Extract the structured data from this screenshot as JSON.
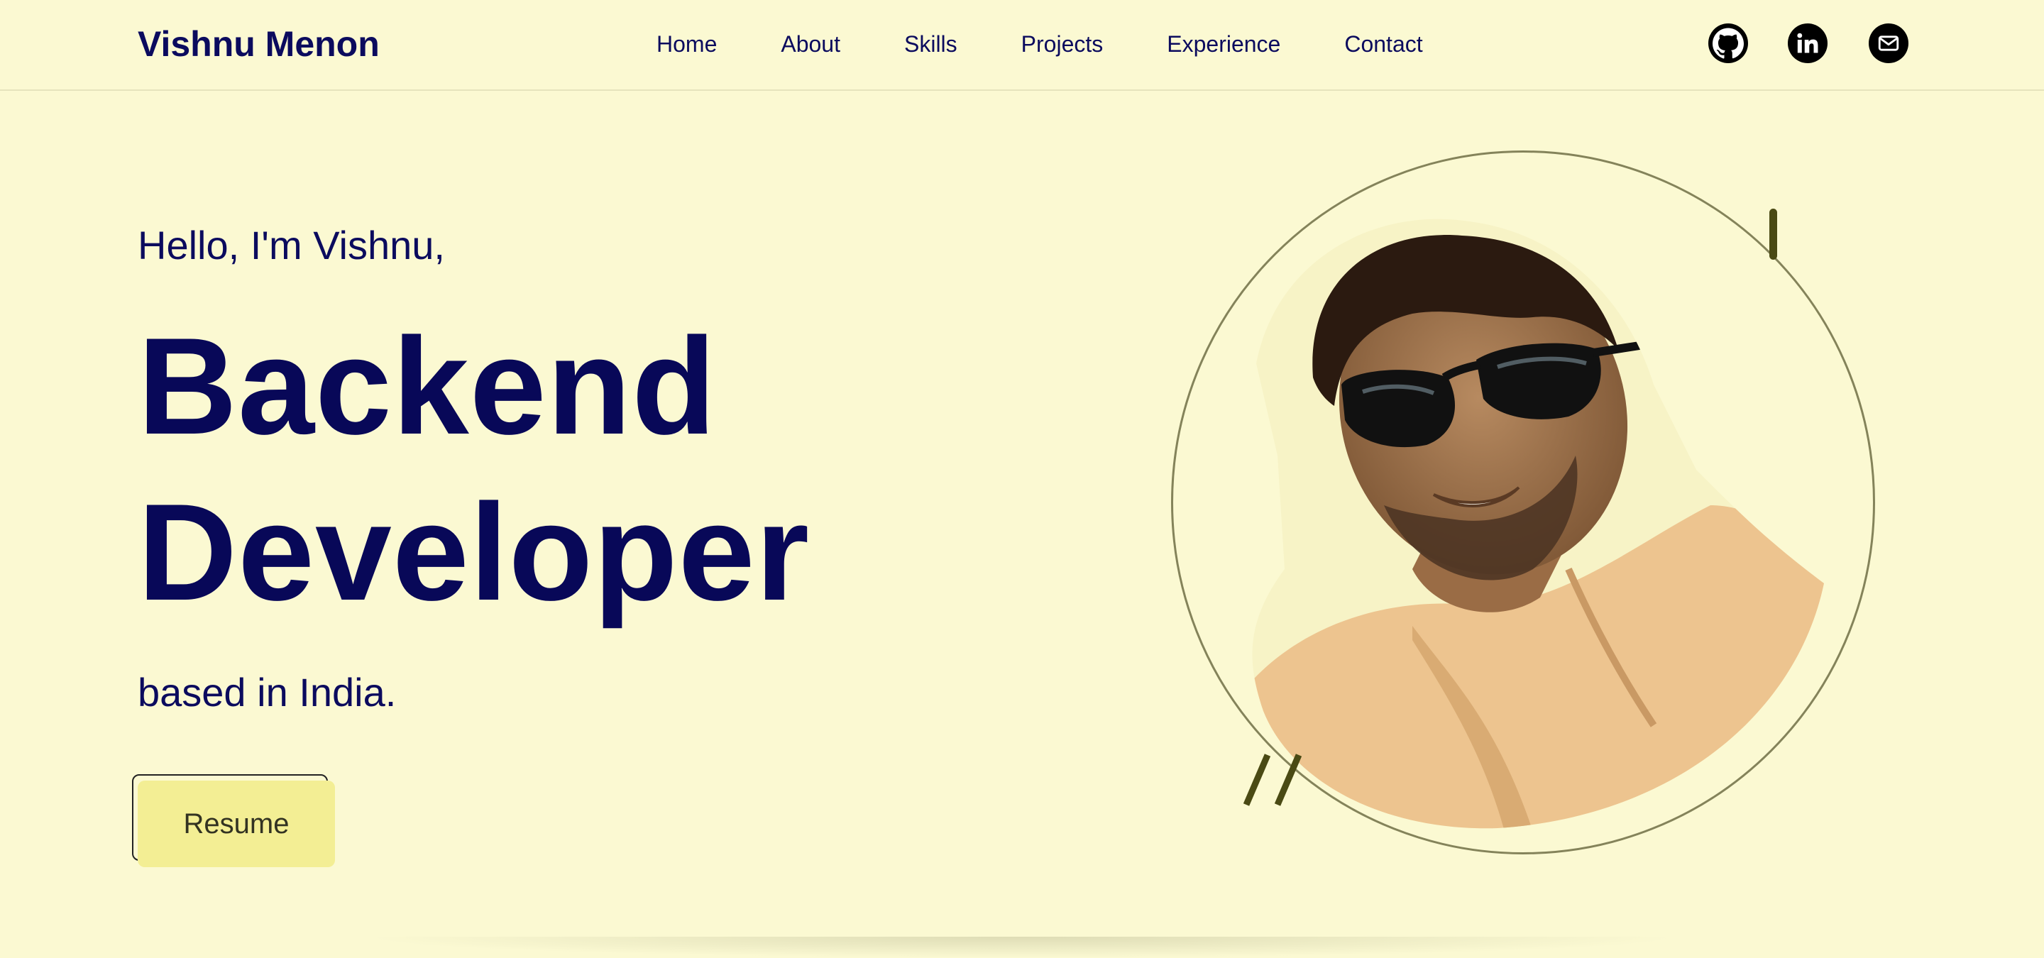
{
  "brand": {
    "name": "Vishnu Menon"
  },
  "nav": {
    "items": [
      {
        "label": "Home"
      },
      {
        "label": "About"
      },
      {
        "label": "Skills"
      },
      {
        "label": "Projects"
      },
      {
        "label": "Experience"
      },
      {
        "label": "Contact"
      }
    ]
  },
  "social": {
    "icons": [
      "github-icon",
      "linkedin-icon",
      "email-icon"
    ]
  },
  "hero": {
    "greeting": "Hello, I'm Vishnu,",
    "headline_line1": "Backend",
    "headline_line2": "Developer",
    "location": "based in India.",
    "resume_label": "Resume"
  },
  "colors": {
    "background": "#fbf9d2",
    "text_navy": "#0b0b5e",
    "button_yellow": "#f3ee94",
    "ring_olive": "#84835a",
    "accent_dark_olive": "#4a4a14"
  }
}
